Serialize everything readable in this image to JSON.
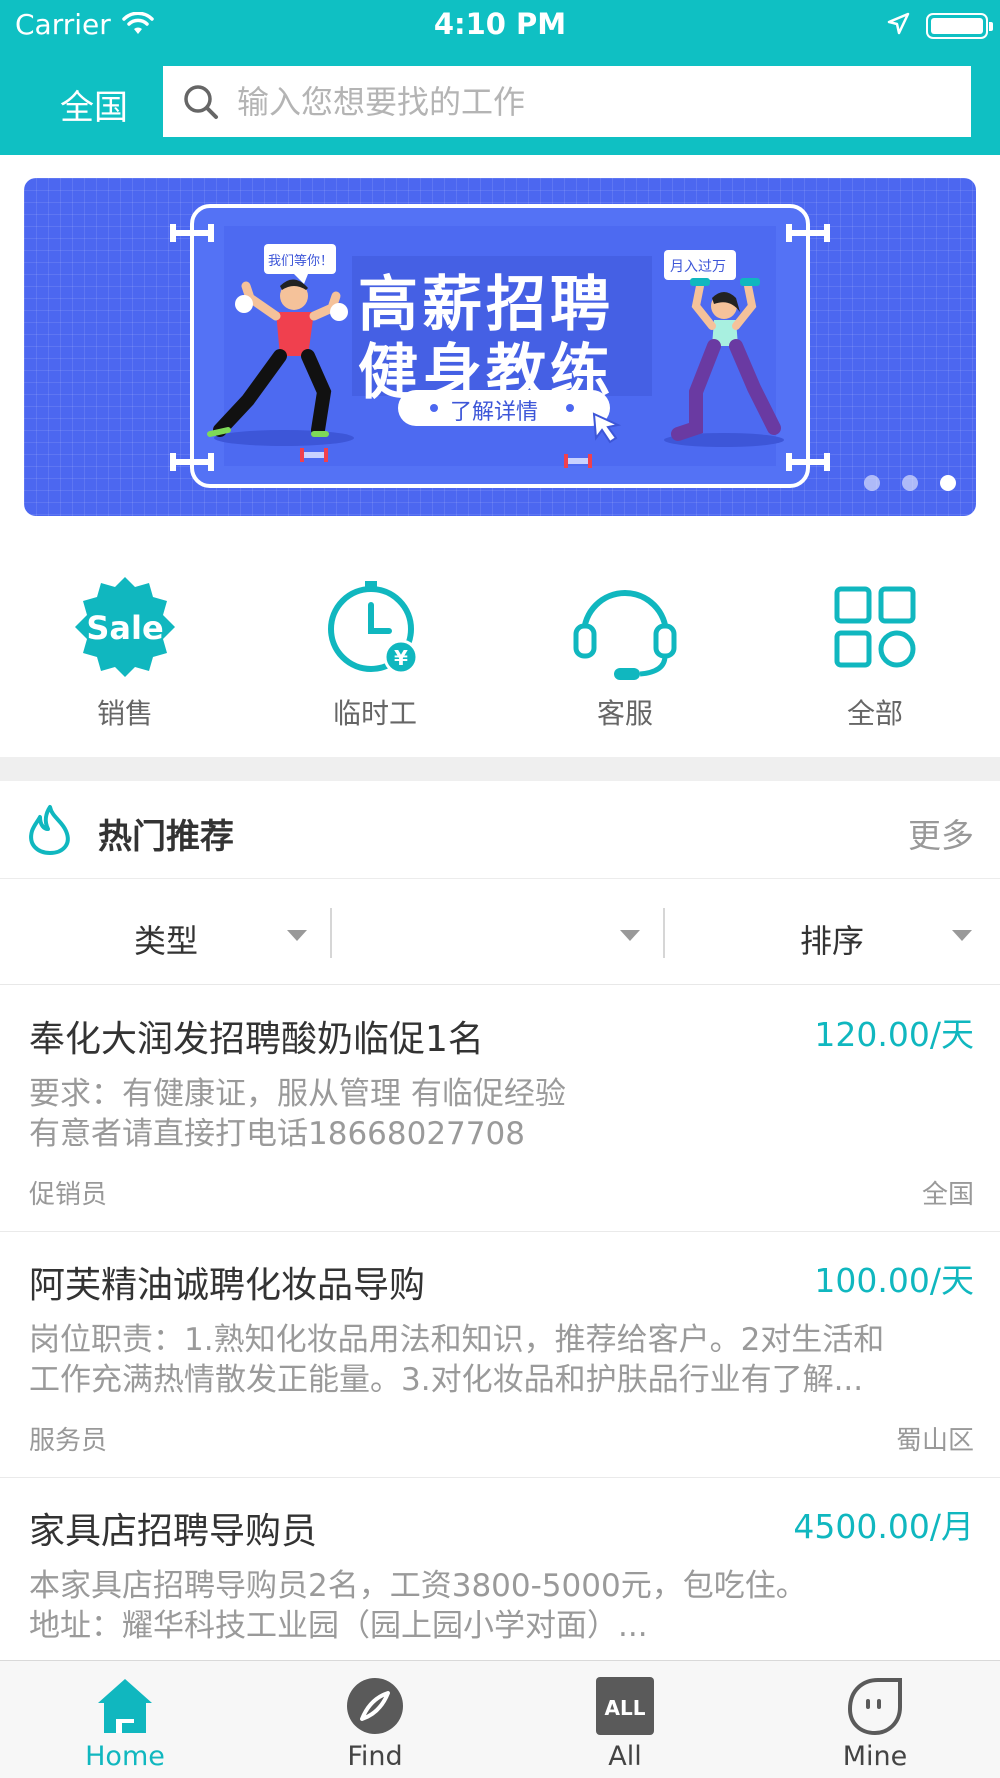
{
  "status_bar": {
    "carrier": "Carrier",
    "time": "4:10 PM"
  },
  "header": {
    "region": "全国",
    "search_placeholder": "输入您想要找的工作",
    "accent": "#0fc0c3"
  },
  "banner": {
    "bubble_left": "我们等你！",
    "bubble_right": "月入过万",
    "headline_1": "高薪招聘",
    "headline_2": "健身教练",
    "cta": "了解详情",
    "slides": 3,
    "active_slide": 3
  },
  "categories": [
    {
      "label": "销售",
      "icon": "sale-badge-icon",
      "badge_text": "Sale"
    },
    {
      "label": "临时工",
      "icon": "clock-yen-icon",
      "badge_text": "¥"
    },
    {
      "label": "客服",
      "icon": "headset-icon"
    },
    {
      "label": "全部",
      "icon": "grid-icon"
    }
  ],
  "hot": {
    "title": "热门推荐",
    "more": "更多",
    "icon": "flame-icon"
  },
  "filters": [
    {
      "label": "类型"
    },
    {
      "label": ""
    },
    {
      "label": "排序"
    }
  ],
  "jobs": [
    {
      "title": "奉化大润发招聘酸奶临促1名",
      "pay": "120.00/天",
      "desc_lines": [
        "要求：有健康证，服从管理 有临促经验",
        "有意者请直接打电话18668027708"
      ],
      "category": "促销员",
      "area": "全国"
    },
    {
      "title": "阿芙精油诚聘化妆品导购",
      "pay": "100.00/天",
      "desc_lines": [
        "岗位职责：1.熟知化妆品用法和知识，推荐给客户。2对生活和",
        "工作充满热情散发正能量。3.对化妆品和护肤品行业有了解..."
      ],
      "category": "服务员",
      "area": "蜀山区"
    },
    {
      "title": "家具店招聘导购员",
      "pay": "4500.00/月",
      "desc_lines": [
        "本家具店招聘导购员2名，工资3800-5000元，包吃住。",
        "地址：耀华科技工业园（园上园小学对面）..."
      ],
      "category": "",
      "area": ""
    }
  ],
  "tabbar": [
    {
      "label": "Home",
      "icon": "home-icon",
      "active": true
    },
    {
      "label": "Find",
      "icon": "compass-icon",
      "active": false
    },
    {
      "label": "All",
      "icon": "all-icon",
      "badge_text": "ALL",
      "active": false
    },
    {
      "label": "Mine",
      "icon": "profile-face-icon",
      "active": false
    }
  ]
}
